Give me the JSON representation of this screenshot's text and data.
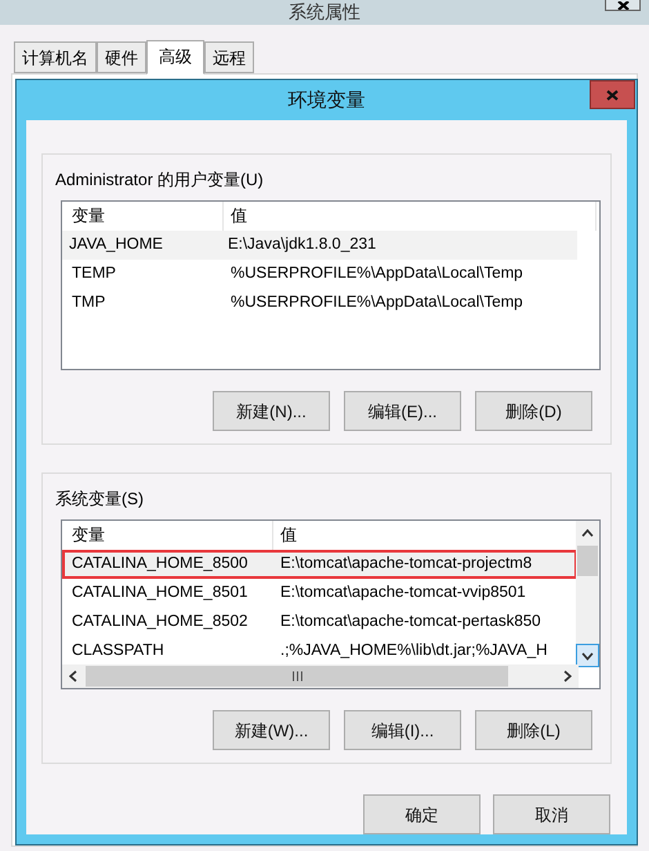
{
  "outer_window": {
    "title": "系统属性"
  },
  "tabs": [
    {
      "label": "计算机名",
      "selected": false
    },
    {
      "label": "硬件",
      "selected": false
    },
    {
      "label": "高级",
      "selected": true
    },
    {
      "label": "远程",
      "selected": false
    }
  ],
  "dialog": {
    "title": "环境变量",
    "user_group": {
      "title": "Administrator 的用户变量(U)",
      "columns": [
        "变量",
        "值"
      ],
      "rows": [
        {
          "name": "JAVA_HOME",
          "value": "E:\\Java\\jdk1.8.0_231",
          "selected": true
        },
        {
          "name": "TEMP",
          "value": "%USERPROFILE%\\AppData\\Local\\Temp",
          "selected": false
        },
        {
          "name": "TMP",
          "value": "%USERPROFILE%\\AppData\\Local\\Temp",
          "selected": false
        }
      ],
      "buttons": [
        "新建(N)...",
        "编辑(E)...",
        "删除(D)"
      ]
    },
    "system_group": {
      "title": "系统变量(S)",
      "columns": [
        "变量",
        "值"
      ],
      "rows": [
        {
          "name": "CATALINA_HOME_8500",
          "value": "E:\\tomcat\\apache-tomcat-projectm8",
          "selected": true
        },
        {
          "name": "CATALINA_HOME_8501",
          "value": "E:\\tomcat\\apache-tomcat-vvip8501",
          "selected": false
        },
        {
          "name": "CATALINA_HOME_8502",
          "value": "E:\\tomcat\\apache-tomcat-pertask850",
          "selected": false
        },
        {
          "name": "CLASSPATH",
          "value": ".;%JAVA_HOME%\\lib\\dt.jar;%JAVA_H",
          "selected": false
        }
      ],
      "buttons": [
        "新建(W)...",
        "编辑(I)...",
        "删除(L)"
      ]
    },
    "buttons": [
      "确定",
      "取消"
    ]
  }
}
